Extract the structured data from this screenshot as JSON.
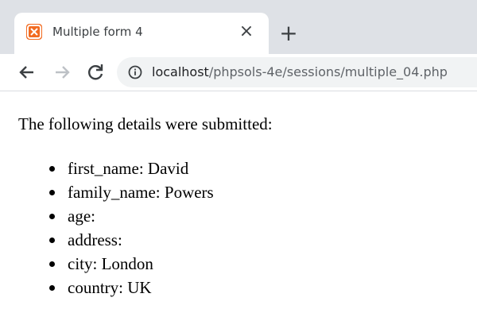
{
  "browser": {
    "tab": {
      "title": "Multiple form 4",
      "close_glyph": "×",
      "favicon": "xampp-icon"
    },
    "new_tab_glyph": "+",
    "address_bar": {
      "host": "localhost",
      "path": "/phpsols-4e/sessions/multiple_04.php"
    },
    "colors": {
      "tab_strip": "#dee1e6",
      "omnibox": "#f1f3f4",
      "favicon": "#f26b21"
    }
  },
  "page": {
    "intro": "The following details were submitted:",
    "details": [
      {
        "label": "first_name",
        "value": "David"
      },
      {
        "label": "family_name",
        "value": "Powers"
      },
      {
        "label": "age",
        "value": ""
      },
      {
        "label": "address",
        "value": ""
      },
      {
        "label": "city",
        "value": "London"
      },
      {
        "label": "country",
        "value": "UK"
      }
    ]
  }
}
